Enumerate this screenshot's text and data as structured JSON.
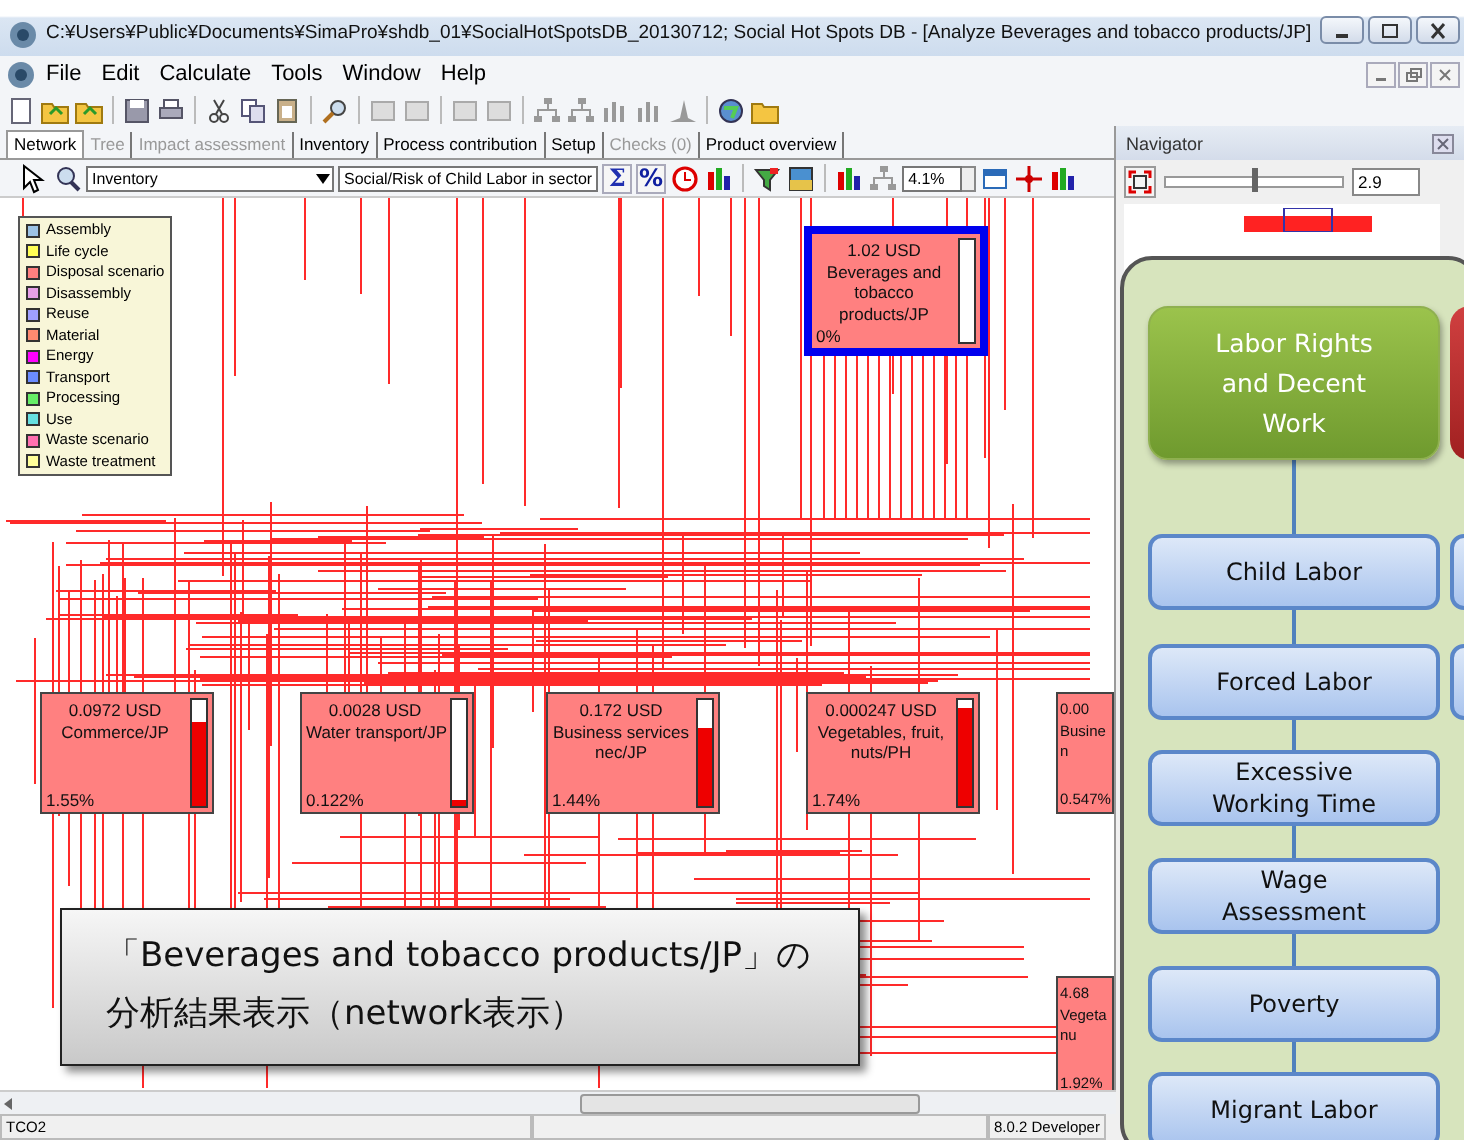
{
  "window": {
    "title": "C:¥Users¥Public¥Documents¥SimaPro¥shdb_01¥SocialHotSpotsDB_20130712; Social Hot Spots DB - [Analyze Beverages and tobacco products/JP]"
  },
  "menu": [
    "File",
    "Edit",
    "Calculate",
    "Tools",
    "Window",
    "Help"
  ],
  "tabs": [
    {
      "label": "Network",
      "selected": true,
      "disabled": false
    },
    {
      "label": "Tree",
      "selected": false,
      "disabled": true
    },
    {
      "label": "Impact assessment",
      "selected": false,
      "disabled": true
    },
    {
      "label": "Inventory",
      "selected": false,
      "disabled": false
    },
    {
      "label": "Process contribution",
      "selected": false,
      "disabled": false
    },
    {
      "label": "Setup",
      "selected": false,
      "disabled": false
    },
    {
      "label": "Checks (0)",
      "selected": false,
      "disabled": true
    },
    {
      "label": "Product overview",
      "selected": false,
      "disabled": false
    }
  ],
  "network_toolbar": {
    "indicator": "Inventory",
    "category": "Social/Risk of Child Labor in sector",
    "sum_button": "Σ",
    "percent_button": "%",
    "cutoff": "4.1%"
  },
  "legend": [
    {
      "label": "Assembly",
      "color": "#9dc3e6"
    },
    {
      "label": "Life cycle",
      "color": "#ffff55"
    },
    {
      "label": "Disposal scenario",
      "color": "#ff8080"
    },
    {
      "label": "Disassembly",
      "color": "#e8a0e8"
    },
    {
      "label": "Reuse",
      "color": "#a0a0ff"
    },
    {
      "label": "Material",
      "color": "#ff8a70"
    },
    {
      "label": "Energy",
      "color": "#ff00ff"
    },
    {
      "label": "Transport",
      "color": "#6b8cff"
    },
    {
      "label": "Processing",
      "color": "#66ee66"
    },
    {
      "label": "Use",
      "color": "#66e0e0"
    },
    {
      "label": "Waste scenario",
      "color": "#ff70b0"
    },
    {
      "label": "Waste treatment",
      "color": "#ffff99"
    }
  ],
  "nodes": [
    {
      "kind": "full",
      "amount": "1.02 USD",
      "lines": [
        "Beverages and",
        "tobacco",
        "products/JP"
      ],
      "share": "0%",
      "level": 0,
      "highlighted": true
    },
    {
      "kind": "full",
      "amount": "0.0972 USD",
      "lines": [
        "Commerce/JP"
      ],
      "share": "1.55%",
      "level": 0.8,
      "highlighted": false
    },
    {
      "kind": "full",
      "amount": "0.0028 USD",
      "lines": [
        "Water transport/JP"
      ],
      "share": "0.122%",
      "level": 0.05,
      "highlighted": false
    },
    {
      "kind": "full",
      "amount": "0.172 USD",
      "lines": [
        "Business services",
        "nec/JP"
      ],
      "share": "1.44%",
      "level": 0.74,
      "highlighted": false
    },
    {
      "kind": "full",
      "amount": "0.000247 USD",
      "lines": [
        "Vegetables, fruit,",
        "nuts/PH"
      ],
      "share": "1.74%",
      "level": 0.92,
      "highlighted": false
    },
    {
      "kind": "clipped",
      "amount": "0.00",
      "lines": [
        "Busine",
        "n"
      ],
      "share": "0.547%"
    },
    {
      "kind": "clipped",
      "amount": "4.68",
      "lines": [
        "Vegeta",
        "nu"
      ],
      "share": "1.92%"
    }
  ],
  "navigator": {
    "title": "Navigator",
    "zoom": "2.9",
    "level": 0.5
  },
  "status_bar": [
    "TCO2",
    "8.0.2 Developer"
  ],
  "overlay": {
    "header": "Labor Rights and Decent Work",
    "items": [
      "Child Labor",
      "Forced Labor",
      "Excessive Working Time",
      "Wage Assessment",
      "Poverty",
      "Migrant Labor"
    ]
  },
  "callout": {
    "lines": [
      "「Beverages and tobacco products/JP」の",
      "分析結果表示（network表示）"
    ]
  }
}
